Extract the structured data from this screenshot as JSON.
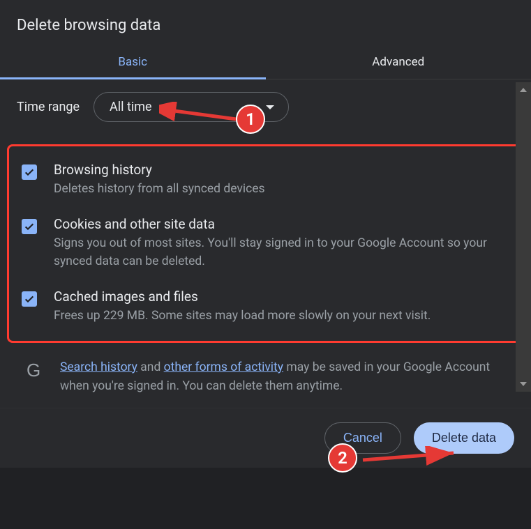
{
  "title": "Delete browsing data",
  "tabs": {
    "basic": "Basic",
    "advanced": "Advanced"
  },
  "time": {
    "label": "Time range",
    "value": "All time"
  },
  "items": [
    {
      "title": "Browsing history",
      "sub": "Deletes history from all synced devices"
    },
    {
      "title": "Cookies and other site data",
      "sub": "Signs you out of most sites. You'll stay signed in to your Google Account so your synced data can be deleted."
    },
    {
      "title": "Cached images and files",
      "sub": "Frees up 229 MB. Some sites may load more slowly on your next visit."
    }
  ],
  "info": {
    "link1": "Search history",
    "mid1": " and ",
    "link2": "other forms of activity",
    "rest": " may be saved in your Google Account when you're signed in. You can delete them anytime."
  },
  "buttons": {
    "cancel": "Cancel",
    "confirm": "Delete data"
  },
  "annotations": {
    "one": "1",
    "two": "2"
  }
}
